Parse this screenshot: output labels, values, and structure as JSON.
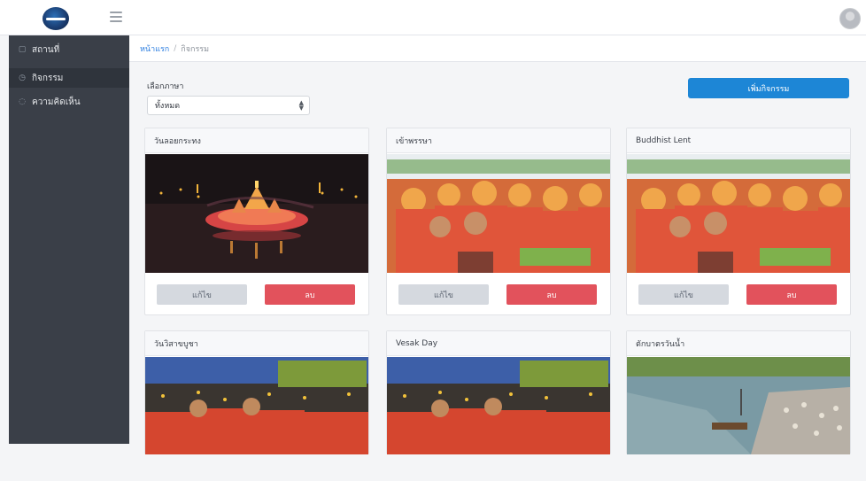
{
  "topbar": {
    "logo_icon": "round-blue-logo",
    "menu_icon": "hamburger-icon",
    "avatar_icon": "user-avatar"
  },
  "sidebar": {
    "items": [
      {
        "label": "สถานที่",
        "icon": "map-icon",
        "active": false
      },
      {
        "label": "กิจกรรม",
        "icon": "calendar-icon",
        "active": true
      },
      {
        "label": "ความคิดเห็น",
        "icon": "comment-icon",
        "active": false
      }
    ]
  },
  "breadcrumb": {
    "home": "หน้าแรก",
    "separator": "/",
    "current": "กิจกรรม"
  },
  "filter": {
    "label": "เลือกภาษา",
    "selected": "ทั้งหมด"
  },
  "add_button": "เพิ่มกิจกรรม",
  "cards": [
    {
      "title": "วันลอยกระทง",
      "image": "loy-krathong-night-lanterns",
      "edit": "แก้ไข",
      "delete": "ลบ"
    },
    {
      "title": "เข้าพรรษา",
      "image": "monks-offering-ceremony",
      "edit": "แก้ไข",
      "delete": "ลบ"
    },
    {
      "title": "Buddhist Lent",
      "image": "monks-offering-ceremony",
      "edit": "แก้ไข",
      "delete": "ลบ"
    },
    {
      "title": "วันวิสาขบูชา",
      "image": "monks-candle-procession"
    },
    {
      "title": "Vesak Day",
      "image": "monks-candle-procession"
    },
    {
      "title": "ตักบาตรวันน้ำ",
      "image": "river-boats-crowd"
    }
  ],
  "colors": {
    "sidebar_bg": "#3a3f48",
    "primary_button": "#1d86d6",
    "delete_button": "#e2525c",
    "edit_button": "#d5d9df",
    "link": "#2b7de0"
  }
}
